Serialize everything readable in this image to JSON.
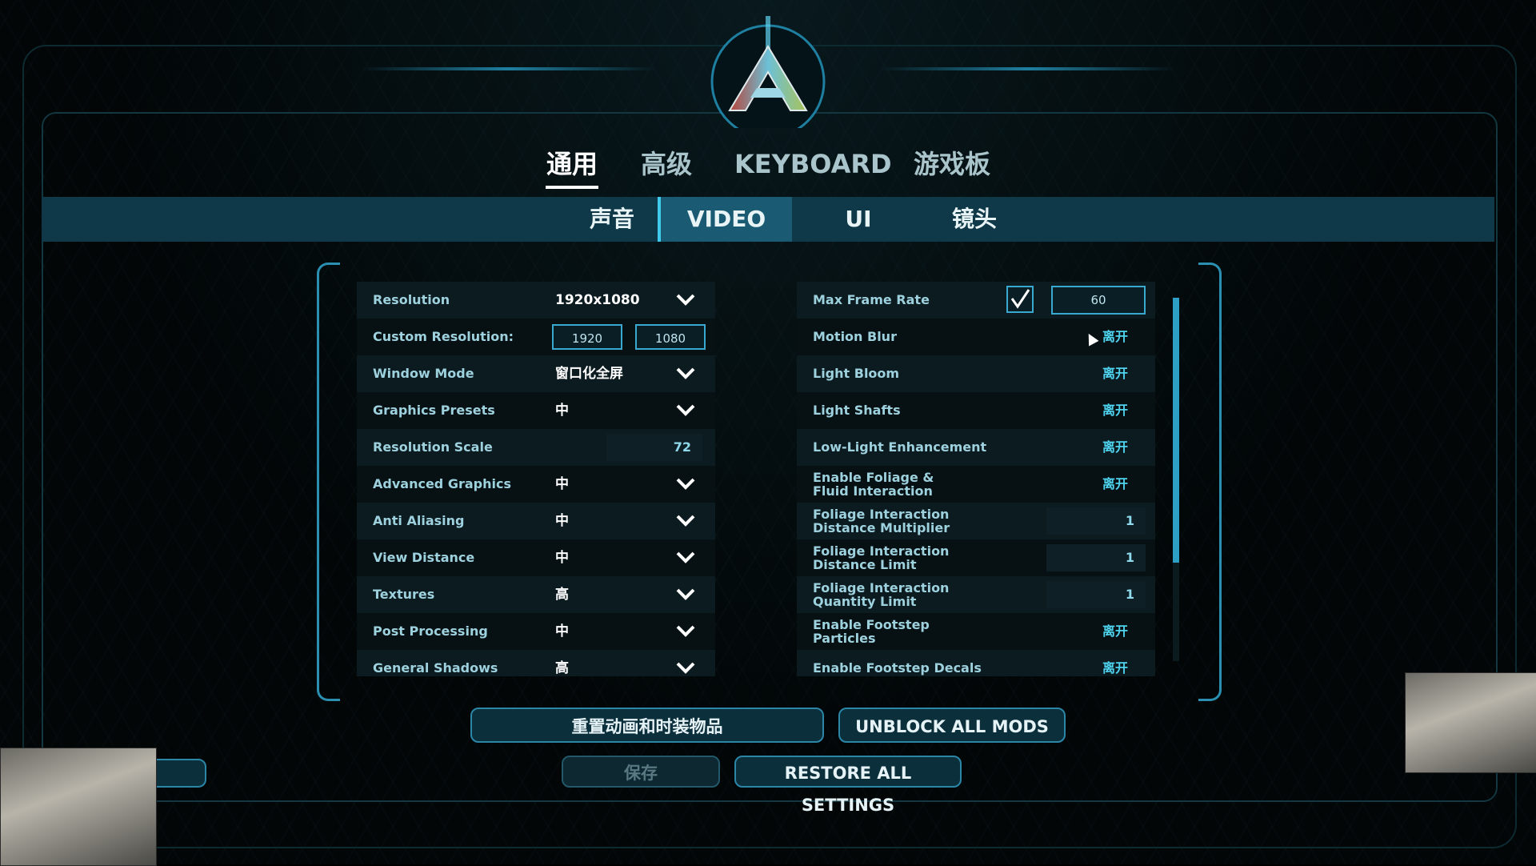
{
  "main_tabs": [
    {
      "label": "通用",
      "active": true
    },
    {
      "label": "高级",
      "active": false
    },
    {
      "label": "KEYBOARD",
      "active": false
    },
    {
      "label": "游戏板",
      "active": false
    }
  ],
  "sub_tabs": [
    {
      "label": "声音",
      "active": false
    },
    {
      "label": "VIDEO",
      "active": true
    },
    {
      "label": "UI",
      "active": false
    },
    {
      "label": "镜头",
      "active": false
    }
  ],
  "left_settings": {
    "resolution": {
      "label": "Resolution",
      "value": "1920x1080"
    },
    "custom_resolution": {
      "label": "Custom Resolution:",
      "width": "1920",
      "height": "1080"
    },
    "window_mode": {
      "label": "Window Mode",
      "value": "窗口化全屏"
    },
    "graphics_presets": {
      "label": "Graphics Presets",
      "value": "中"
    },
    "resolution_scale": {
      "label": "Resolution Scale",
      "value": "72"
    },
    "advanced_graphics": {
      "label": "Advanced Graphics",
      "value": "中"
    },
    "anti_aliasing": {
      "label": "Anti Aliasing",
      "value": "中"
    },
    "view_distance": {
      "label": "View Distance",
      "value": "中"
    },
    "textures": {
      "label": "Textures",
      "value": "高"
    },
    "post_processing": {
      "label": "Post Processing",
      "value": "中"
    },
    "general_shadows": {
      "label": "General Shadows",
      "value": "高"
    }
  },
  "right_settings": {
    "max_frame_rate": {
      "label": "Max Frame Rate",
      "checked": true,
      "value": "60"
    },
    "motion_blur": {
      "label": "Motion Blur",
      "value": "离开"
    },
    "light_bloom": {
      "label": "Light Bloom",
      "value": "离开"
    },
    "light_shafts": {
      "label": "Light Shafts",
      "value": "离开"
    },
    "low_light": {
      "label": "Low-Light Enhancement",
      "value": "离开"
    },
    "foliage_fluid": {
      "label": "Enable Foliage & Fluid Interaction",
      "value": "离开"
    },
    "foliage_dist_mult": {
      "label": "Foliage Interaction Distance Multiplier",
      "value": "1"
    },
    "foliage_dist_limit": {
      "label": "Foliage Interaction Distance Limit",
      "value": "1"
    },
    "foliage_qty_limit": {
      "label": "Foliage Interaction Quantity Limit",
      "value": "1"
    },
    "footstep_particles": {
      "label": "Enable Footstep Particles",
      "value": "离开"
    },
    "footstep_decals": {
      "label": "Enable Footstep Decals",
      "value": "离开"
    }
  },
  "scroll": {
    "thumb_fraction": 0.73
  },
  "buttons": {
    "reset_anim": "重置动画和时装物品",
    "unblock_mods": "UNBLOCK ALL MODS",
    "save": "保存",
    "restore": "RESTORE ALL SETTINGS"
  },
  "icons": [
    "game-logo-icon",
    "chevron-down-icon",
    "checkmark-icon",
    "mouse-cursor-icon"
  ],
  "colors": {
    "accent": "#2b86a8",
    "toggle_text": "#4fd4f0",
    "subbar": "#0f3948"
  }
}
